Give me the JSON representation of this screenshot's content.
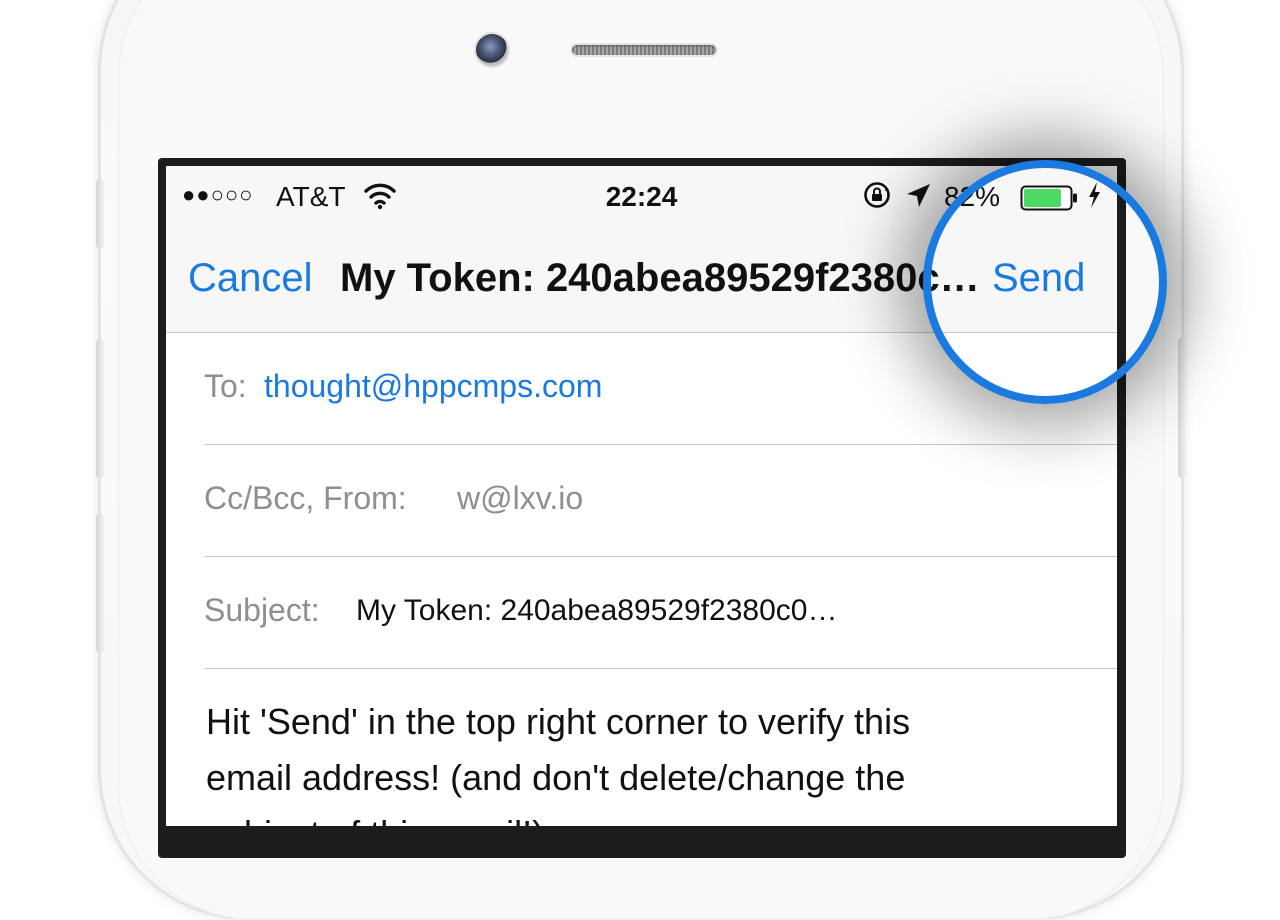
{
  "status_bar": {
    "signal": "●●○○○",
    "carrier": "AT&T",
    "time": "22:24",
    "battery_percent": "82%",
    "battery_level": 0.82,
    "battery_color": "#4cd964"
  },
  "nav": {
    "cancel_label": "Cancel",
    "title": "My Token: 240abea89529f2380c0…",
    "send_label": "Send",
    "accent_color": "#1b7ae0"
  },
  "compose": {
    "to_label": "To:",
    "to_value": "thought@hppcmps.com",
    "ccbcc_label": "Cc/Bcc, From:",
    "from_value": "w@lxv.io",
    "subject_label": "Subject:",
    "subject_value": "My Token: 240abea89529f2380c0…",
    "body_line1": "Hit 'Send' in the top right corner to verify this",
    "body_line2": "email address! (and don't delete/change the",
    "body_line3": "subject of this email!)"
  },
  "icons": [
    "wifi-icon",
    "rotation-lock-icon",
    "location-arrow-icon",
    "battery-icon",
    "charging-bolt-icon"
  ]
}
